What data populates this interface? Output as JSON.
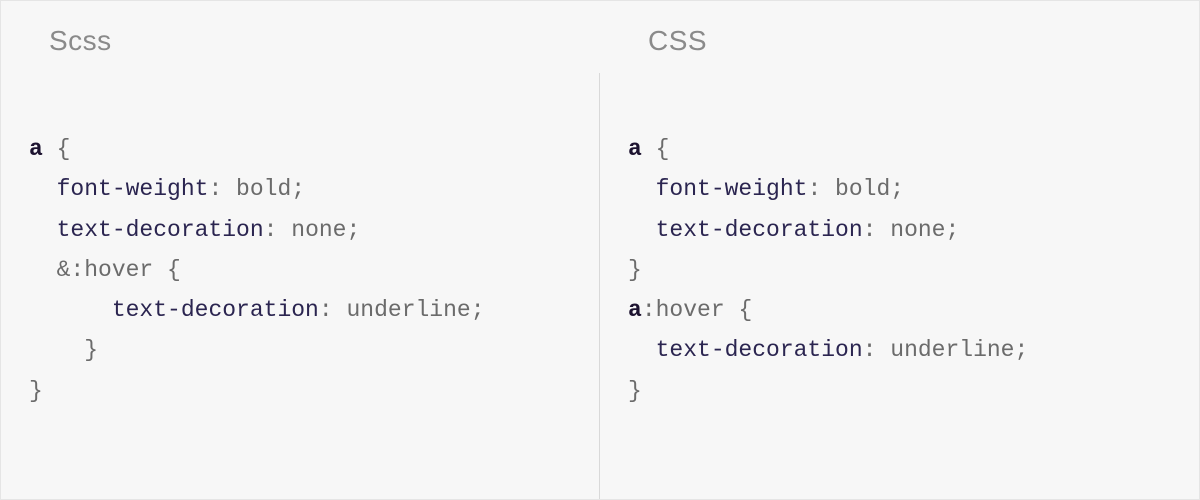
{
  "left": {
    "title": "Scss",
    "code": {
      "l1": {
        "sel": "a",
        "open": " {"
      },
      "l2": {
        "indent": "  ",
        "prop": "font-weight",
        "colon": ": ",
        "val": "bold",
        "semi": ";"
      },
      "l3": {
        "indent": "  ",
        "prop": "text-decoration",
        "colon": ": ",
        "val": "none",
        "semi": ";"
      },
      "l4": {
        "indent": "  ",
        "amp": "&:hover",
        "open": " {"
      },
      "l5": {
        "indent": "      ",
        "prop": "text-decoration",
        "colon": ": ",
        "val": "underline",
        "semi": ";"
      },
      "l6": {
        "indent": "    ",
        "close": "}"
      },
      "l7": {
        "close": "}"
      }
    }
  },
  "right": {
    "title": "CSS",
    "code": {
      "l1": {
        "sel": "a",
        "open": " {"
      },
      "l2": {
        "indent": "  ",
        "prop": "font-weight",
        "colon": ": ",
        "val": "bold",
        "semi": ";"
      },
      "l3": {
        "indent": "  ",
        "prop": "text-decoration",
        "colon": ": ",
        "val": "none",
        "semi": ";"
      },
      "l4": {
        "close": "}"
      },
      "l5": {
        "sel": "a",
        "pseudo": ":hover",
        "open": " {"
      },
      "l6": {
        "indent": "  ",
        "prop": "text-decoration",
        "colon": ": ",
        "val": "underline",
        "semi": ";"
      },
      "l7": {
        "close": "}"
      }
    }
  }
}
